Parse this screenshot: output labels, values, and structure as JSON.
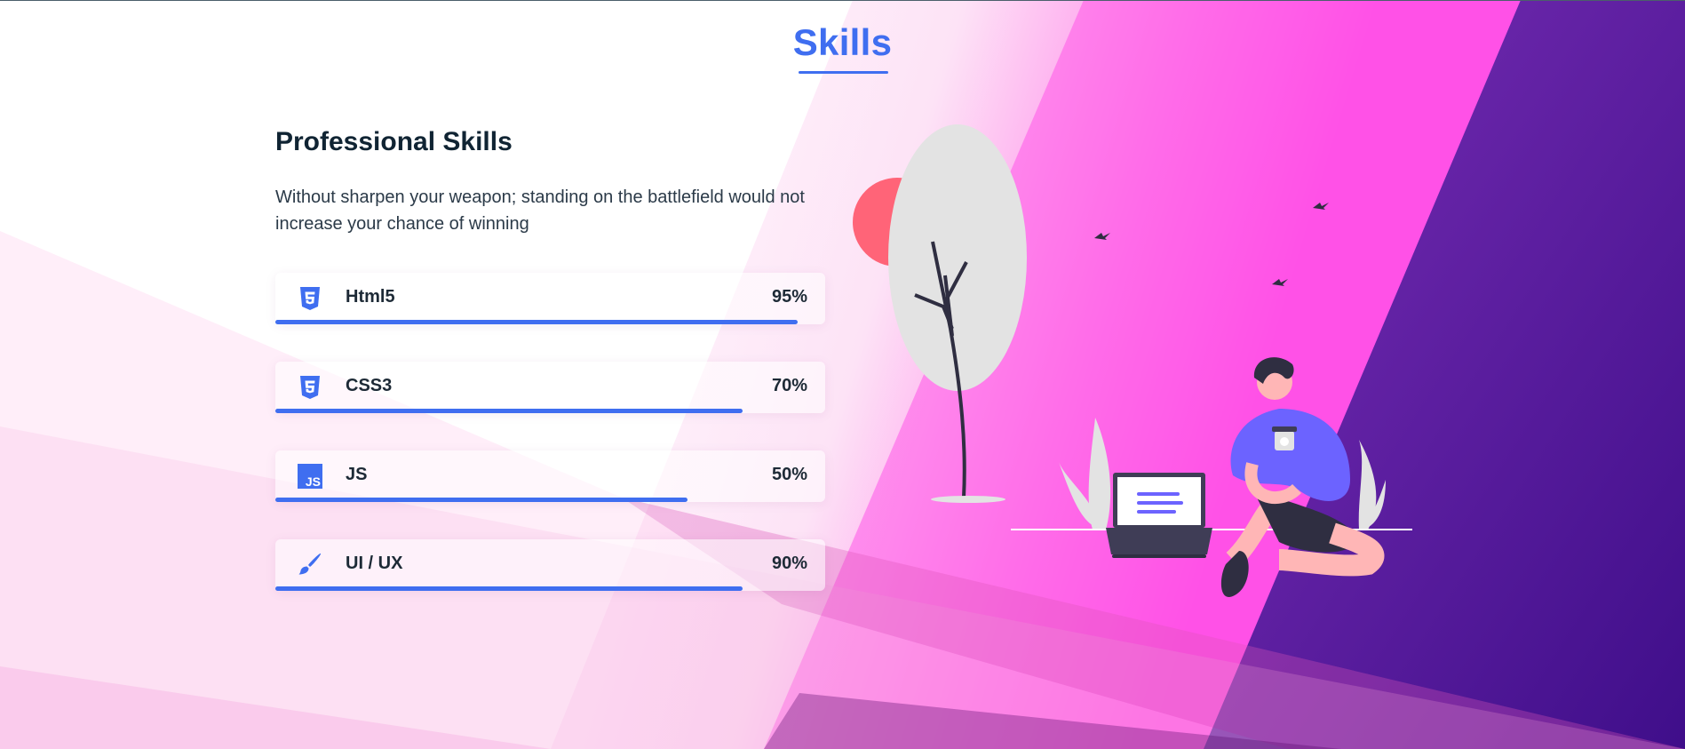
{
  "section": {
    "title": "Skills"
  },
  "intro": {
    "heading": "Professional Skills",
    "description": "Without sharpen your weapon; standing on the battlefield would not increase your chance of winning"
  },
  "skills": [
    {
      "name": "Html5",
      "percent_label": "95%",
      "percent": 95,
      "icon": "html5-icon"
    },
    {
      "name": "CSS3",
      "percent_label": "70%",
      "percent": 85,
      "icon": "css3-icon"
    },
    {
      "name": "JS",
      "percent_label": "50%",
      "percent": 75,
      "icon": "js-icon"
    },
    {
      "name": "UI / UX",
      "percent_label": "90%",
      "percent": 85,
      "icon": "paintbrush-icon"
    }
  ],
  "colors": {
    "accent": "#3f6ef0",
    "heading": "#102433",
    "magenta": "#ff4de6",
    "purple": "#4b1694",
    "illustration_accent": "#6c63ff",
    "sun": "#ff6478"
  }
}
